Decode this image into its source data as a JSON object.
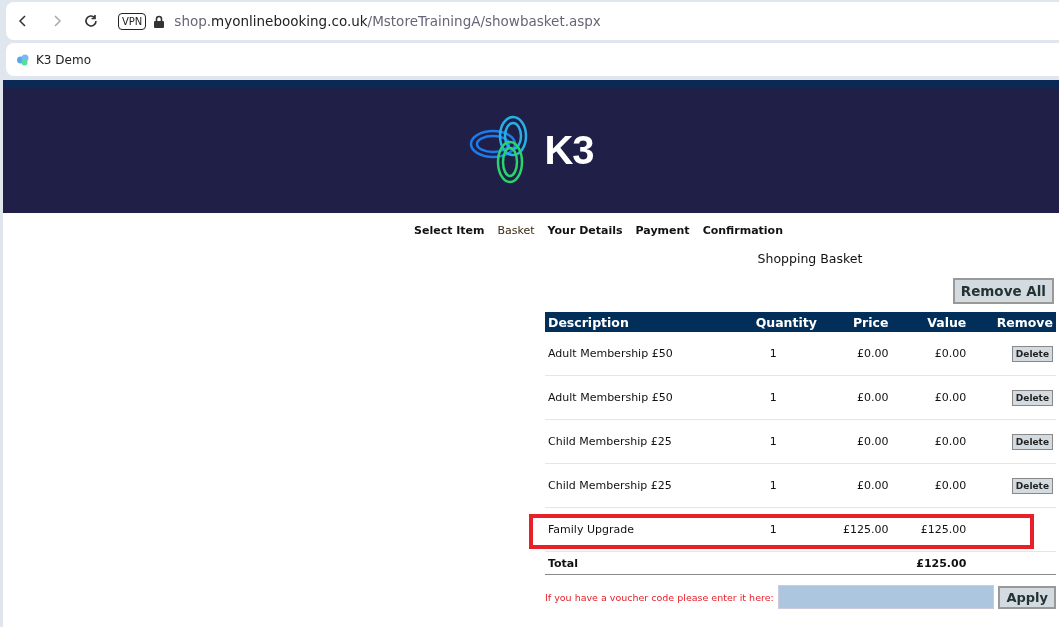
{
  "browser": {
    "vpn": "VPN",
    "url": {
      "subdomain": "shop.",
      "domain": "myonlinebooking.co.uk",
      "path": "/MstoreTrainingA/showbasket.aspx"
    },
    "bookmark": "K3 Demo"
  },
  "header": {
    "logo_text": "K3"
  },
  "steps": [
    {
      "label": "Select Item",
      "selected": false
    },
    {
      "label": "Basket",
      "selected": true
    },
    {
      "label": "Your Details",
      "selected": false
    },
    {
      "label": "Payment",
      "selected": false
    },
    {
      "label": "Confirmation",
      "selected": false
    }
  ],
  "basket": {
    "title": "Shopping Basket",
    "remove_all": "Remove All",
    "columns": [
      "Description",
      "Quantity",
      "Price",
      "Value",
      "Remove"
    ],
    "rows": [
      {
        "description": "Adult Membership £50",
        "quantity": "1",
        "price": "£0.00",
        "value": "£0.00",
        "action": "Delete",
        "highlighted": false
      },
      {
        "description": "Adult Membership £50",
        "quantity": "1",
        "price": "£0.00",
        "value": "£0.00",
        "action": "Delete",
        "highlighted": false
      },
      {
        "description": "Child Membership £25",
        "quantity": "1",
        "price": "£0.00",
        "value": "£0.00",
        "action": "Delete",
        "highlighted": false
      },
      {
        "description": "Child Membership £25",
        "quantity": "1",
        "price": "£0.00",
        "value": "£0.00",
        "action": "Delete",
        "highlighted": false
      },
      {
        "description": "Family Upgrade",
        "quantity": "1",
        "price": "£125.00",
        "value": "£125.00",
        "highlighted": true
      }
    ],
    "total_label": "Total",
    "total_value": "£125.00",
    "voucher_prompt": "If you have a voucher code please enter it here:",
    "apply": "Apply"
  }
}
